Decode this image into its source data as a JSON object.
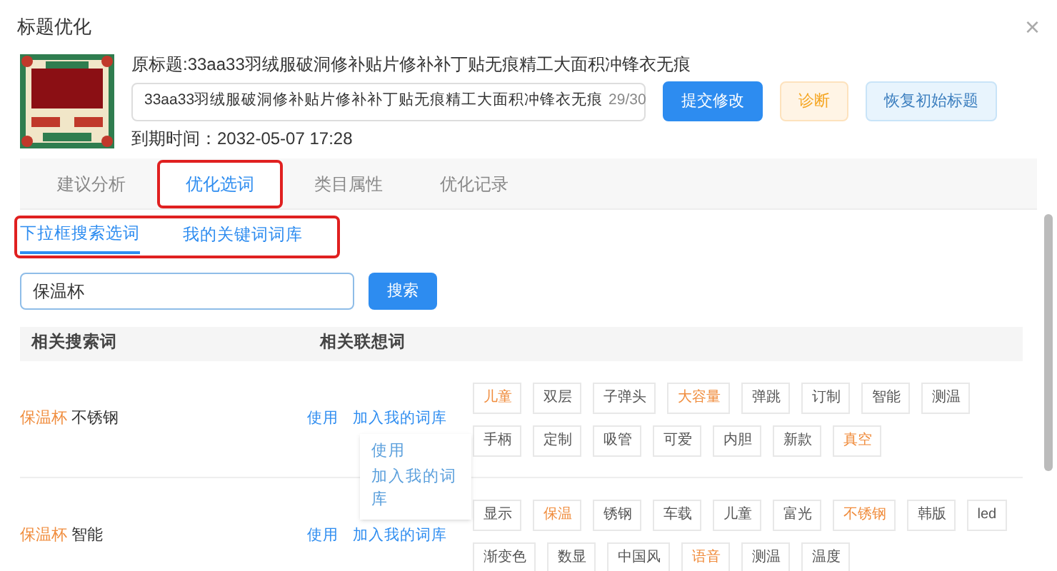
{
  "dialog": {
    "title": "标题优化",
    "close": "×"
  },
  "product": {
    "original_title": "原标题:33aa33羽绒服破洞修补贴片修补补丁贴无痕精工大面积冲锋衣无痕",
    "title_value": "33aa33羽绒服破洞修补贴片修补补丁贴无痕精工大面积冲锋衣无痕",
    "count": "29/30",
    "expiry": "到期时间：2032-05-07 17:28",
    "buttons": [
      {
        "label": "提交修改",
        "kind": "primary"
      },
      {
        "label": "诊断",
        "kind": "warning"
      },
      {
        "label": "恢复初始标题",
        "kind": "info"
      }
    ]
  },
  "tabs": [
    {
      "label": "建议分析",
      "selected": false,
      "annotated": false
    },
    {
      "label": "优化选词",
      "selected": true,
      "annotated": true
    },
    {
      "label": "类目属性",
      "selected": false,
      "annotated": false
    },
    {
      "label": "优化记录",
      "selected": false,
      "annotated": false
    }
  ],
  "subtabs": {
    "annotated": true,
    "items": [
      {
        "label": "下拉框搜索选词",
        "selected": true
      },
      {
        "label": "我的关键词词库",
        "selected": false
      }
    ]
  },
  "search": {
    "value": "保温杯",
    "button": "搜索"
  },
  "table": {
    "columns": [
      "相关搜索词",
      "相关联想词"
    ],
    "rows": [
      {
        "keyword": "保温杯",
        "suffix": "不锈钢",
        "actions": [
          "使用",
          "加入我的词库"
        ],
        "tags": [
          {
            "text": "儿童",
            "hot": true
          },
          {
            "text": "双层",
            "hot": false
          },
          {
            "text": "子弹头",
            "hot": false
          },
          {
            "text": "大容量",
            "hot": true
          },
          {
            "text": "弹跳",
            "hot": false
          },
          {
            "text": "订制",
            "hot": false
          },
          {
            "text": "智能",
            "hot": false
          },
          {
            "text": "测温",
            "hot": false
          },
          {
            "text": "手柄",
            "hot": false
          },
          {
            "text": "定制",
            "hot": false
          },
          {
            "text": "吸管",
            "hot": false
          },
          {
            "text": "可爱",
            "hot": false
          },
          {
            "text": "内胆",
            "hot": false
          },
          {
            "text": "新款",
            "hot": false
          },
          {
            "text": "真空",
            "hot": true
          }
        ]
      },
      {
        "keyword": "保温杯",
        "suffix": "智能",
        "actions": [
          "使用",
          "加入我的词库"
        ],
        "tags": [
          {
            "text": "显示",
            "hot": false
          },
          {
            "text": "保温",
            "hot": true
          },
          {
            "text": "锈钢",
            "hot": false
          },
          {
            "text": "车载",
            "hot": false
          },
          {
            "text": "儿童",
            "hot": false
          },
          {
            "text": "富光",
            "hot": false
          },
          {
            "text": "不锈钢",
            "hot": true
          },
          {
            "text": "韩版",
            "hot": false
          },
          {
            "text": "led",
            "hot": false
          },
          {
            "text": "渐变色",
            "hot": false
          },
          {
            "text": "数显",
            "hot": false
          },
          {
            "text": "中国风",
            "hot": false
          },
          {
            "text": "语音",
            "hot": true
          },
          {
            "text": "测温",
            "hot": false
          },
          {
            "text": "温度",
            "hot": false
          }
        ]
      }
    ]
  },
  "popup": {
    "items": [
      "使用",
      "加入我的词库"
    ]
  }
}
